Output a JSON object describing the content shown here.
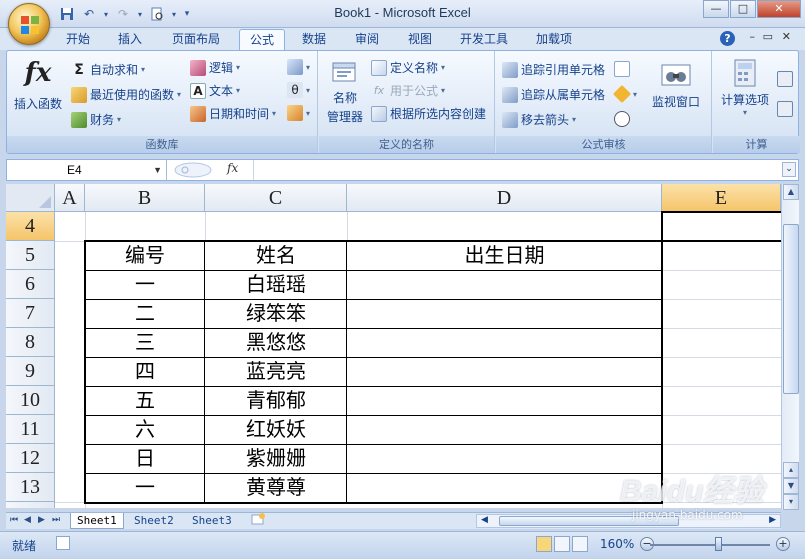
{
  "window": {
    "title": "Book1 - Microsoft Excel",
    "controls": [
      "—",
      "□",
      "✕"
    ]
  },
  "ribbon_tabs": [
    "开始",
    "插入",
    "页面布局",
    "公式",
    "数据",
    "审阅",
    "视图",
    "开发工具",
    "加载项"
  ],
  "active_tab": "公式",
  "ribbon": {
    "function_library": {
      "label": "函数库",
      "insert_function": "插入函数",
      "autosum": "自动求和",
      "recent": "最近使用的函数",
      "financial": "财务",
      "logical": "逻辑",
      "text": "文本",
      "datetime": "日期和时间"
    },
    "defined_names": {
      "label": "定义的名称",
      "name_manager_line1": "名称",
      "name_manager_line2": "管理器",
      "define_name": "定义名称",
      "use_in_formula": "用于公式",
      "create_from_selection": "根据所选内容创建"
    },
    "formula_auditing": {
      "label": "公式审核",
      "trace_precedents": "追踪引用单元格",
      "trace_dependents": "追踪从属单元格",
      "remove_arrows": "移去箭头",
      "watch_window": "监视窗口"
    },
    "calculation": {
      "label": "计算",
      "calc_options": "计算选项"
    }
  },
  "formula_bar": {
    "name_box": "E4",
    "fx": "fx",
    "formula": ""
  },
  "sheet": {
    "column_headers": [
      "A",
      "B",
      "C",
      "D",
      "E"
    ],
    "selected_column": "E",
    "row_headers": [
      "4",
      "5",
      "6",
      "7",
      "8",
      "9",
      "10",
      "11",
      "12",
      "13"
    ],
    "selected_row": "4",
    "table_header": [
      "编号",
      "姓名",
      "出生日期"
    ],
    "rows": [
      [
        "一",
        "白瑶瑶",
        ""
      ],
      [
        "二",
        "绿笨笨",
        ""
      ],
      [
        "三",
        "黑悠悠",
        ""
      ],
      [
        "四",
        "蓝亮亮",
        ""
      ],
      [
        "五",
        "青郁郁",
        ""
      ],
      [
        "六",
        "红妖妖",
        ""
      ],
      [
        "日",
        "紫姗姗",
        ""
      ],
      [
        "一",
        "黄尊尊",
        ""
      ]
    ]
  },
  "sheet_tabs": [
    "Sheet1",
    "Sheet2",
    "Sheet3"
  ],
  "active_sheet": "Sheet1",
  "status_bar": {
    "ready": "就绪",
    "zoom": "160%",
    "zoom_minus": "−",
    "zoom_plus": "+"
  },
  "watermark": {
    "brand": "Baidu经验",
    "url": "jingyan.baidu.com"
  },
  "colors": {
    "ribbon_bg": "#dde8f6",
    "selection_header": "#f5c46a",
    "grid_line": "#d4dbe5"
  }
}
